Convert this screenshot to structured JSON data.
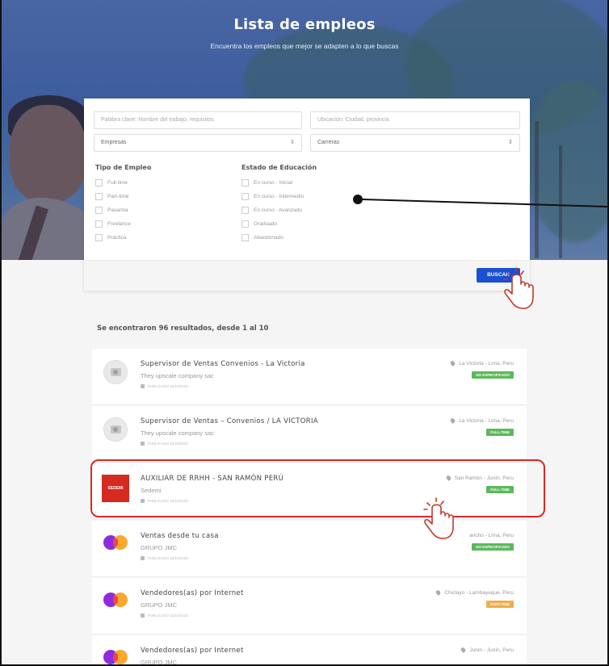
{
  "hero": {
    "title": "Lista de empleos",
    "subtitle": "Encuentra los empleos que mejor se adapten a lo que buscas"
  },
  "search": {
    "keyword_placeholder": "Palabra clave: Nombre del trabajo, requisitos",
    "location_placeholder": "Ubicación: Ciudad, provincia",
    "company_select": "Empresas",
    "career_select": "Carreras",
    "employment_type": {
      "title": "Tipo de Empleo",
      "options": [
        "Full-time",
        "Part-time",
        "Pasantía",
        "Freelance",
        "Práctica"
      ]
    },
    "education_status": {
      "title": "Estado de Educación",
      "options": [
        "En curso - Inicial",
        "En curso - Intermedio",
        "En curso - Avanzado",
        "Graduado",
        "Abandonado"
      ]
    },
    "search_button": "BUSCAR"
  },
  "results": {
    "summary": "Se encontraron 96 resultados, desde 1 al 10",
    "jobs": [
      {
        "title": "Supervisor de Ventas Convenios - La Victoria",
        "company": "They upscale company sac",
        "published": "PUBLICADO 15/10/2020",
        "location": "La Victoria - Lima, Peru",
        "badge": "NO ESPECIFICADO",
        "badge_color": "#5cb85c",
        "logo": "camera-icon"
      },
      {
        "title": "Supervisor de Ventas – Convenios / LA VICTORIA",
        "company": "They upscale company sac",
        "published": "PUBLICADO 15/10/2020",
        "location": "La Victoria - Lima, Peru",
        "badge": "FULL-TIME",
        "badge_color": "#5cb85c",
        "logo": "camera-icon"
      },
      {
        "title": "AUXILIAR DE RRHH - SAN RAMÓN PERÚ",
        "company": "Sedemi",
        "published": "PUBLICADO 15/10/2020",
        "location": "San Ramón - Junín, Peru",
        "badge": "FULL-TIME",
        "badge_color": "#5cb85c",
        "logo": "sedemi-logo"
      },
      {
        "title": "Ventas desde tu casa",
        "company": "GRUPO JMC",
        "published": "PUBLICADO 15/10/2020",
        "location": "ancho - Lima, Peru",
        "badge": "NO ESPECIFICADO",
        "badge_color": "#5cb85c",
        "logo": "mastercard-logo"
      },
      {
        "title": "Vendedores(as) por Internet",
        "company": "GRUPO JMC",
        "published": "PUBLICADO 15/10/2020",
        "location": "Chiclayo - Lambayeque, Peru",
        "badge": "PART-TIME",
        "badge_color": "#f0ad4e",
        "logo": "mastercard-logo"
      },
      {
        "title": "Vendedores(as) por Internet",
        "company": "GRUPO JMC",
        "published": "",
        "location": "Junin - Junín, Peru",
        "badge": "",
        "badge_color": "#f0ad4e",
        "logo": "mastercard-logo"
      }
    ]
  },
  "sedemi_logo_text": "SEDEMI"
}
